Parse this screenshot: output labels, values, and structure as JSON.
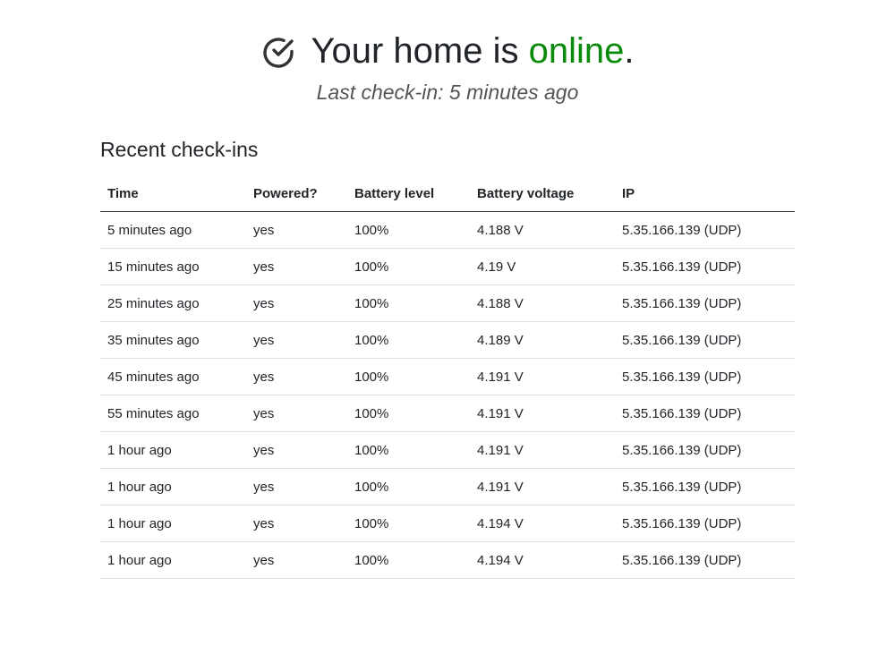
{
  "header": {
    "prefix": "Your home is",
    "status": "online",
    "suffix": ".",
    "subtitle": "Last check-in: 5 minutes ago",
    "status_color": "#0a8a0a",
    "icon": "check-circle-icon"
  },
  "section": {
    "title": "Recent check-ins"
  },
  "table": {
    "headers": [
      "Time",
      "Powered?",
      "Battery level",
      "Battery voltage",
      "IP"
    ],
    "rows": [
      [
        "5 minutes ago",
        "yes",
        "100%",
        "4.188 V",
        "5.35.166.139 (UDP)"
      ],
      [
        "15 minutes ago",
        "yes",
        "100%",
        "4.19 V",
        "5.35.166.139 (UDP)"
      ],
      [
        "25 minutes ago",
        "yes",
        "100%",
        "4.188 V",
        "5.35.166.139 (UDP)"
      ],
      [
        "35 minutes ago",
        "yes",
        "100%",
        "4.189 V",
        "5.35.166.139 (UDP)"
      ],
      [
        "45 minutes ago",
        "yes",
        "100%",
        "4.191 V",
        "5.35.166.139 (UDP)"
      ],
      [
        "55 minutes ago",
        "yes",
        "100%",
        "4.191 V",
        "5.35.166.139 (UDP)"
      ],
      [
        "1 hour ago",
        "yes",
        "100%",
        "4.191 V",
        "5.35.166.139 (UDP)"
      ],
      [
        "1 hour ago",
        "yes",
        "100%",
        "4.191 V",
        "5.35.166.139 (UDP)"
      ],
      [
        "1 hour ago",
        "yes",
        "100%",
        "4.194 V",
        "5.35.166.139 (UDP)"
      ],
      [
        "1 hour ago",
        "yes",
        "100%",
        "4.194 V",
        "5.35.166.139 (UDP)"
      ]
    ]
  }
}
